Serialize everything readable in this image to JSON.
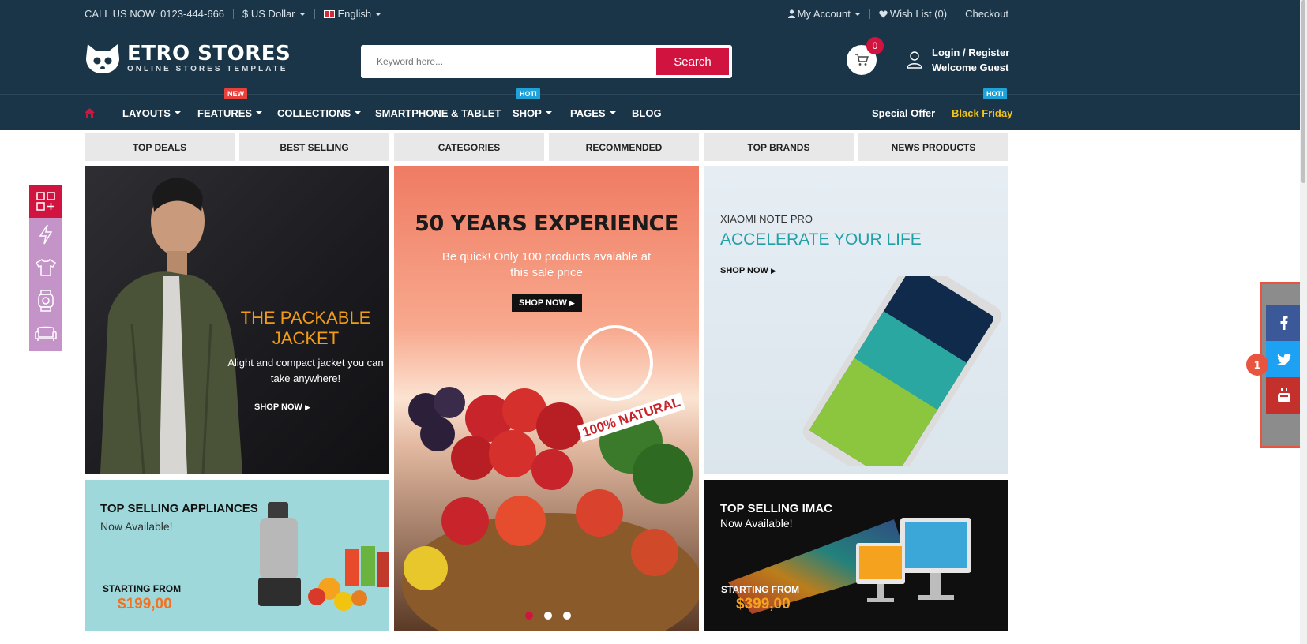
{
  "topbar": {
    "phone": "CALL US NOW: 0123-444-666",
    "currency": "$ US Dollar",
    "language": "English",
    "my_account": "My Account",
    "wishlist": "Wish List (0)",
    "checkout": "Checkout"
  },
  "header": {
    "logo_title": "ETRO STORES",
    "logo_sub": "ONLINE STORES TEMPLATE",
    "search_placeholder": "Keyword here...",
    "search_button": "Search",
    "cart_count": "0",
    "login": "Login",
    "slash": "/",
    "register": "Register",
    "welcome": "Welcome Guest"
  },
  "nav": {
    "items": [
      {
        "label": "LAYOUTS"
      },
      {
        "label": "FEATURES",
        "badge": "NEW"
      },
      {
        "label": "COLLECTIONS"
      },
      {
        "label": "SMARTPHONE & TABLET"
      },
      {
        "label": "SHOP",
        "badge": "HOT!"
      },
      {
        "label": "PAGES"
      },
      {
        "label": "BLOG"
      }
    ],
    "special_offer": "Special Offer",
    "black_friday": "Black Friday",
    "black_friday_badge": "HOT!"
  },
  "tabs": [
    "TOP DEALS",
    "BEST SELLING",
    "CATEGORIES",
    "RECOMMENDED",
    "TOP BRANDS",
    "NEWS PRODUCTS"
  ],
  "banners": {
    "jacket": {
      "title": "THE PACKABLE JACKET",
      "text": "Alight and compact jacket you can take anywhere!",
      "cta": "SHOP NOW"
    },
    "experience": {
      "title": "50 YEARS EXPERIENCE",
      "text": "Be quick! Only 100 products avaiable at this sale price",
      "cta": "SHOP NOW",
      "stamp": "100% NATURAL"
    },
    "xiaomi": {
      "subtitle": "XIAOMI NOTE PRO",
      "title": "ACCELERATE YOUR LIFE",
      "cta": "SHOP NOW"
    },
    "appliances": {
      "title": "TOP SELLING APPLIANCES",
      "subtitle": "Now Available!",
      "from": "STARTING FROM",
      "price": "$199,00"
    },
    "imac": {
      "title": "TOP SELLING IMAC",
      "subtitle": "Now Available!",
      "from": "STARTING FROM",
      "price": "$399,00"
    }
  },
  "slider_dots": {
    "count": 3,
    "active": 0
  },
  "annotation_marker": "1",
  "colors": {
    "dark_navy": "#1b3548",
    "accent_red": "#d0143f",
    "orange": "#f39b16",
    "teal": "#22a0a8",
    "yellow": "#f5c518",
    "facebook": "#3b5998",
    "twitter": "#1da1f2",
    "youtube": "#c4302b"
  },
  "icons": {
    "cart": "shopping-cart-icon",
    "account": "user-icon",
    "home": "home-icon",
    "left_bar": [
      "apps-add-icon",
      "lightning-icon",
      "tshirt-icon",
      "smartwatch-icon",
      "sofa-icon"
    ],
    "social": [
      "facebook-icon",
      "twitter-icon",
      "youtube-icon"
    ]
  }
}
